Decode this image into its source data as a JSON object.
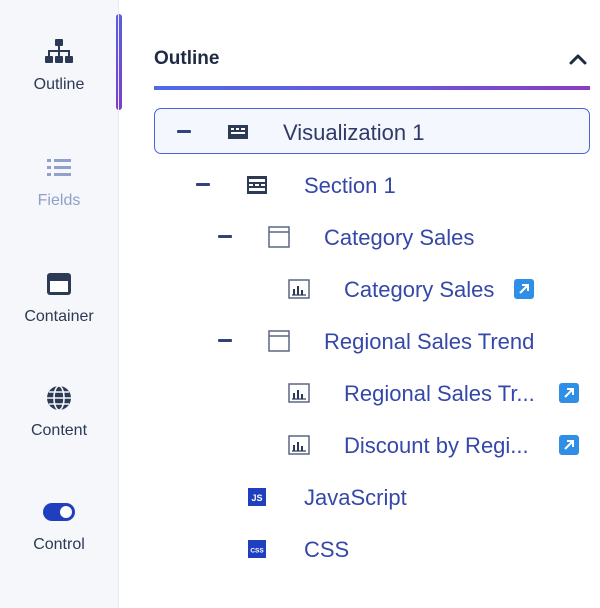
{
  "rail": {
    "items": [
      {
        "label": "Outline",
        "icon": "sitemap-icon",
        "state": "active"
      },
      {
        "label": "Fields",
        "icon": "list-icon",
        "state": "disabled"
      },
      {
        "label": "Container",
        "icon": "container-icon",
        "state": "normal"
      },
      {
        "label": "Content",
        "icon": "globe-icon",
        "state": "normal"
      },
      {
        "label": "Control",
        "icon": "toggle-icon",
        "state": "normal"
      }
    ],
    "indicator_color": "#6b4fd8"
  },
  "outline": {
    "title": "Outline",
    "collapse_icon": "chevron-up-icon",
    "tree": [
      {
        "label": "Visualization 1",
        "icon": "visualization-icon",
        "expanded": true,
        "selected": true
      },
      {
        "label": "Section 1",
        "icon": "section-icon",
        "expanded": true
      },
      {
        "label": "Category Sales",
        "icon": "container-box-icon",
        "expanded": true
      },
      {
        "label": "Category Sales",
        "icon": "chart-icon",
        "link": "open-link-icon"
      },
      {
        "label": "Regional Sales Trend",
        "icon": "container-box-icon",
        "expanded": true
      },
      {
        "label": "Regional Sales Tr...",
        "icon": "chart-icon",
        "link": "open-link-icon"
      },
      {
        "label": "Discount by Regi...",
        "icon": "chart-icon",
        "link": "open-link-icon"
      },
      {
        "label": "JavaScript",
        "icon": "js-icon"
      },
      {
        "label": "CSS",
        "icon": "css-icon"
      }
    ]
  },
  "colors": {
    "accent": "#4f6be8",
    "node_text": "#3548a8",
    "link_badge": "#2f8ee6"
  }
}
